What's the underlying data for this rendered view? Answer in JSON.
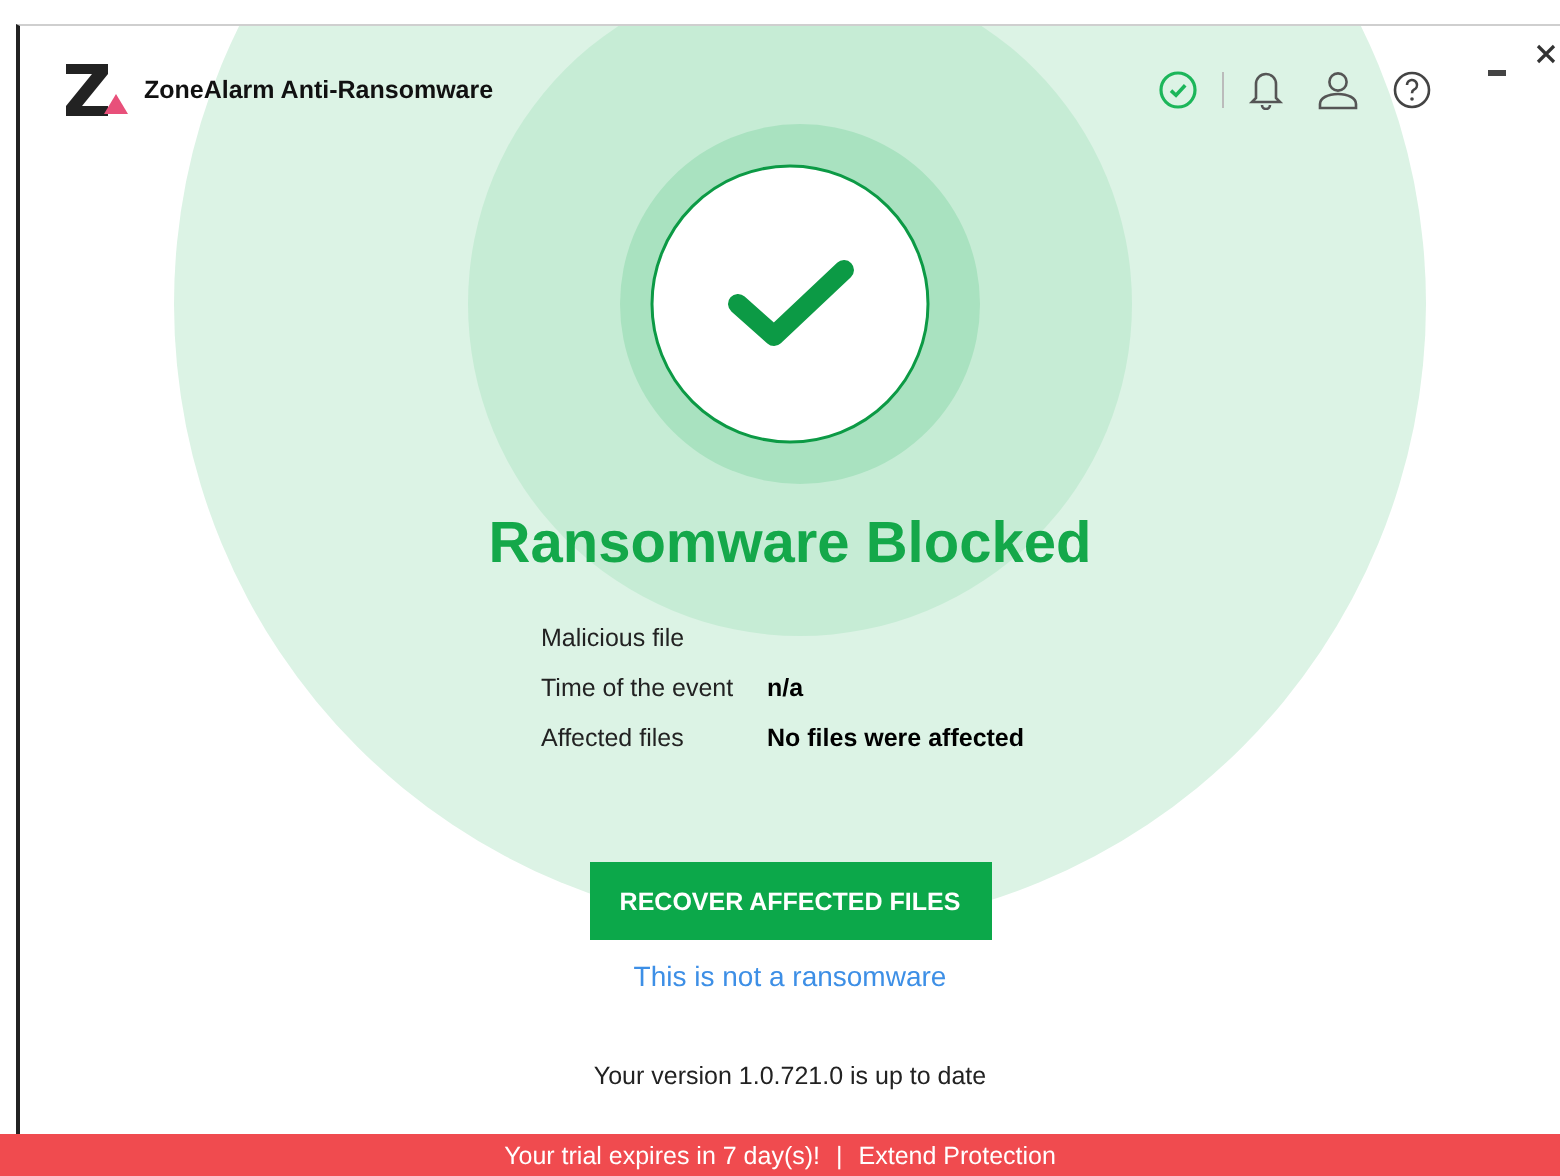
{
  "app": {
    "title": "ZoneAlarm Anti-Ransomware"
  },
  "status": {
    "title": "Ransomware Blocked"
  },
  "details": [
    {
      "label": "Malicious file"
    },
    {
      "label": "Time of the event",
      "value": "n/a"
    },
    {
      "label": "Affected files",
      "value": "No files were affected"
    }
  ],
  "primary_button": "RECOVER AFFECTED FILES",
  "secondary_link": "This is not a ransomware",
  "version_text": "Your version 1.0.721.0 is up to date",
  "trial_bar": {
    "message": "Your trial expires in 7 day(s)!",
    "separator": "|",
    "link": "Extend Protection"
  }
}
